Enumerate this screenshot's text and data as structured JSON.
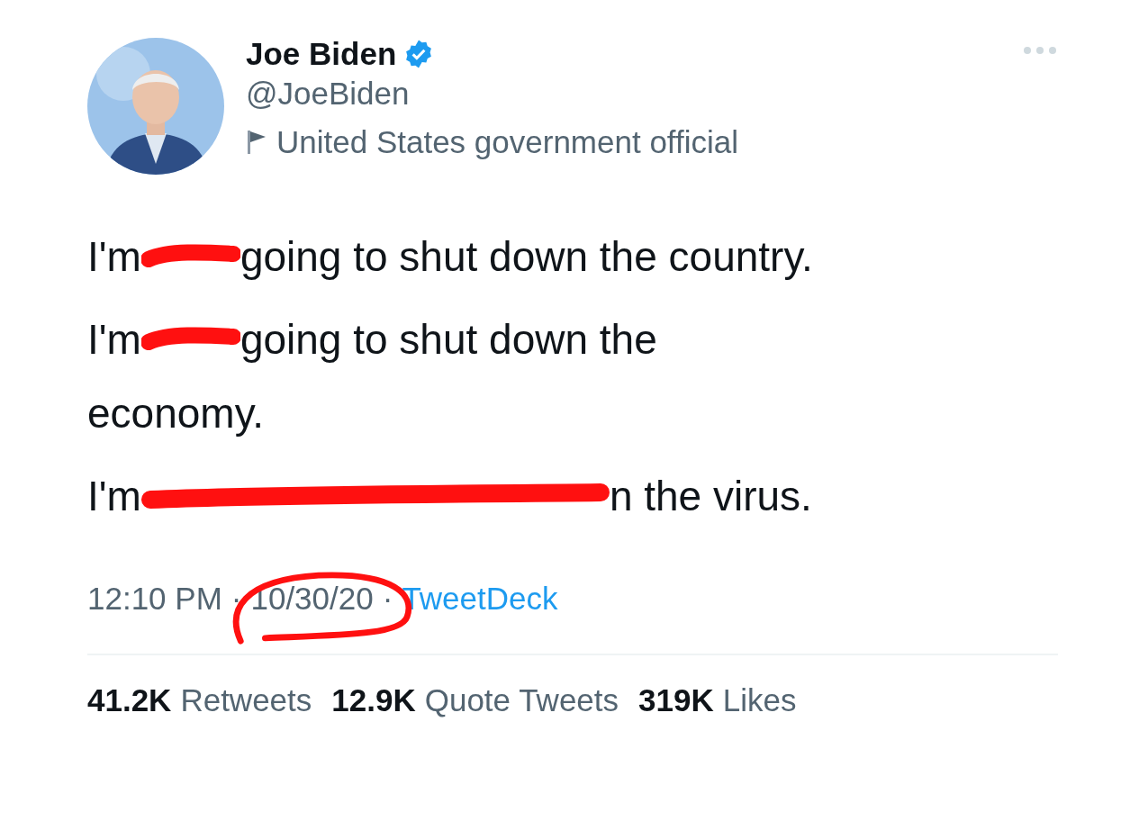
{
  "author": {
    "name": "Joe Biden",
    "verified": true,
    "handle": "@JoeBiden",
    "label": "United States government official"
  },
  "paragraphs": [
    {
      "lines": [
        [
          {
            "kind": "text",
            "text": "I'm"
          },
          {
            "kind": "scribble"
          },
          {
            "kind": "text",
            "text": "going to shut down the country."
          }
        ]
      ]
    },
    {
      "lines": [
        [
          {
            "kind": "text",
            "text": "I'm"
          },
          {
            "kind": "scribble"
          },
          {
            "kind": "text",
            "text": "going to shut down the"
          }
        ],
        [
          {
            "kind": "text",
            "text": "economy."
          }
        ]
      ]
    },
    {
      "lines": [
        [
          {
            "kind": "text",
            "text": "I'm"
          },
          {
            "kind": "long_scribble"
          },
          {
            "kind": "text",
            "text": "n the virus."
          }
        ]
      ]
    }
  ],
  "meta": {
    "time": "12:10 PM",
    "separator_1": "·",
    "date": "10/30/20",
    "date_circled": true,
    "separator_2": "·",
    "source": "TweetDeck"
  },
  "stats": [
    {
      "count": "41.2K",
      "label": "Retweets"
    },
    {
      "count": "12.9K",
      "label": "Quote Tweets"
    },
    {
      "count": "319K",
      "label": "Likes"
    }
  ]
}
